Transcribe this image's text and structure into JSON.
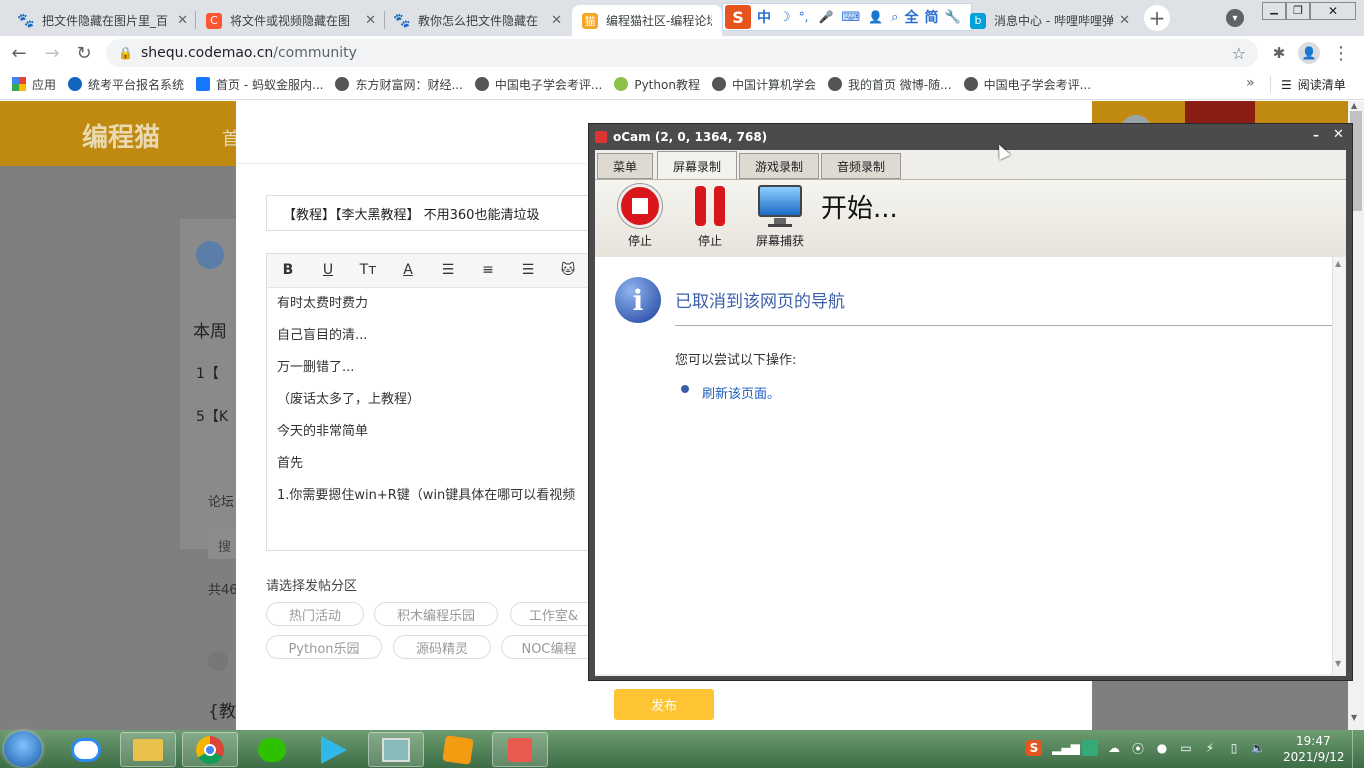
{
  "browser": {
    "tabs": [
      {
        "title": "把文件隐藏在图片里_百",
        "icon": "baidu-icon",
        "color": "#2932e1"
      },
      {
        "title": "将文件或视频隐藏在图",
        "icon": "csdn-icon",
        "color": "#fc5531"
      },
      {
        "title": "教你怎么把文件隐藏在",
        "icon": "baidu-icon",
        "color": "#2932e1"
      },
      {
        "title": "编程猫社区-编程论坛",
        "icon": "codemao-icon",
        "color": "#f5a623"
      },
      {
        "title": "消息中心 - 哔哩哔哩弹",
        "icon": "bilibili-icon",
        "color": "#00a1d6"
      }
    ],
    "ime_toolbar": [
      "S",
      "中",
      "☽",
      "°,",
      "mic",
      "⌨",
      "user",
      "search",
      "全",
      "简",
      "wrench"
    ],
    "url_host": "shequ.codemao.cn",
    "url_path": "/community",
    "bookmarks": [
      "应用",
      "统考平台报名系统",
      "首页 - 蚂蚁金服内...",
      "东方财富网：财经...",
      "中国电子学会考评...",
      "Python教程",
      "中国计算机学会",
      "我的首页 微博-随...",
      "中国电子学会考评..."
    ],
    "bookmarks_more": "»",
    "reading_list": "阅读清单"
  },
  "site": {
    "logo": "编程猫",
    "nav_first": "首",
    "left_items": [
      "本周",
      "1【",
      "5【K",
      "论坛",
      "搜",
      "共46",
      "{教"
    ]
  },
  "post": {
    "title": "【教程】【李大黑教程】 不用360也能清垃圾",
    "editor_lines": [
      "有时太费时费力",
      "自己盲目的清...",
      "万一删错了...",
      "（废话太多了，上教程）",
      "今天的非常简单",
      "首先",
      "1.你需要摁住win+R键（win键具体在哪可以看视频"
    ],
    "section_label": "请选择发帖分区",
    "sections_row1": [
      "热门活动",
      "积木编程乐园",
      "工作室&"
    ],
    "sections_row2": [
      "Python乐园",
      "源码精灵",
      "NOC编程"
    ],
    "publish": "发布"
  },
  "ocam": {
    "title": "oCam (2, 0, 1364, 768)",
    "tabs": [
      "菜单",
      "屏幕录制",
      "游戏录制",
      "音频录制"
    ],
    "buttons": [
      "停止",
      "停止",
      "屏幕捕获"
    ],
    "status": "开始...",
    "message_title": "已取消到该网页的导航",
    "suggest": "您可以尝试以下操作:",
    "refresh_link": "刷新该页面。",
    "accent": "#3b5fa8"
  },
  "taskbar": {
    "time": "19:47",
    "date": "2021/9/12"
  }
}
